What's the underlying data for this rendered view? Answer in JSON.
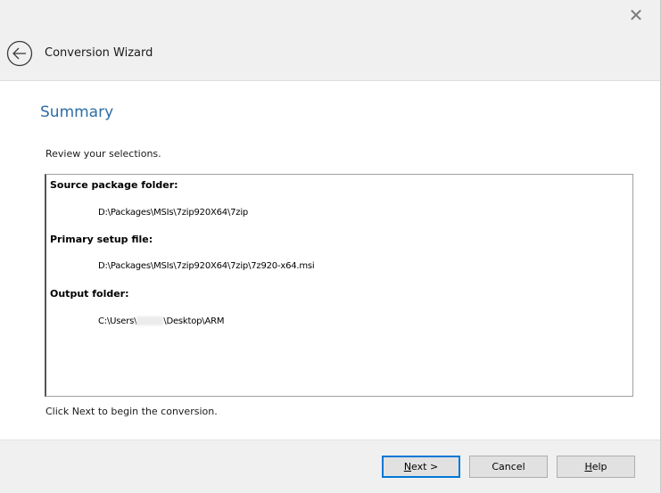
{
  "window": {
    "close_glyph": "✕",
    "title": "Conversion Wizard"
  },
  "page": {
    "heading": "Summary",
    "review_text": "Review your selections.",
    "hint_text": "Click Next to begin the conversion."
  },
  "summary": {
    "source_label": "Source package folder:",
    "source_value": "D:\\Packages\\MSIs\\7zip920X64\\7zip",
    "primary_label": "Primary setup file:",
    "primary_value": "D:\\Packages\\MSIs\\7zip920X64\\7zip\\7z920-x64.msi",
    "output_label": "Output folder:",
    "output_value_prefix": "C:\\Users\\",
    "output_value_suffix": "\\Desktop\\ARM"
  },
  "buttons": {
    "next_accel": "N",
    "next_rest": "ext >",
    "cancel": "Cancel",
    "help_accel": "H",
    "help_rest": "elp"
  },
  "colors": {
    "heading": "#2e6da4",
    "chrome_bg": "#f0f0f0",
    "default_button_border": "#0078d7"
  }
}
